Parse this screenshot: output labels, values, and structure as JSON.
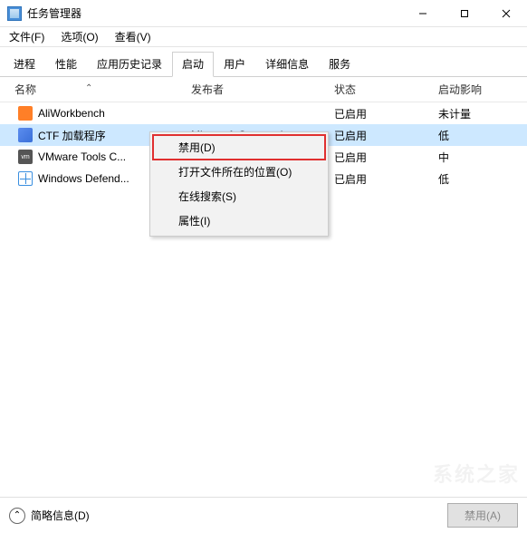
{
  "titlebar": {
    "title": "任务管理器"
  },
  "menubar": {
    "file": "文件(F)",
    "options": "选项(O)",
    "view": "查看(V)"
  },
  "tabs": {
    "items": [
      {
        "label": "进程"
      },
      {
        "label": "性能"
      },
      {
        "label": "应用历史记录"
      },
      {
        "label": "启动"
      },
      {
        "label": "用户"
      },
      {
        "label": "详细信息"
      },
      {
        "label": "服务"
      }
    ],
    "active_index": 3
  },
  "columns": {
    "name": "名称",
    "publisher": "发布者",
    "status": "状态",
    "impact": "启动影响"
  },
  "rows": [
    {
      "name": "AliWorkbench",
      "publisher": "",
      "status": "已启用",
      "impact": "未计量",
      "icon": "ali"
    },
    {
      "name": "CTF 加载程序",
      "publisher": "Microsoft Corporation",
      "status": "已启用",
      "impact": "低",
      "icon": "ctf",
      "selected": true
    },
    {
      "name": "VMware Tools C...",
      "publisher": "",
      "status": "已启用",
      "impact": "中",
      "icon": "vm"
    },
    {
      "name": "Windows Defend...",
      "publisher": "",
      "status": "已启用",
      "impact": "低",
      "icon": "def"
    }
  ],
  "context_menu": {
    "items": [
      {
        "label": "禁用(D)",
        "highlight": true
      },
      {
        "label": "打开文件所在的位置(O)"
      },
      {
        "label": "在线搜索(S)"
      },
      {
        "label": "属性(I)"
      }
    ]
  },
  "statusbar": {
    "detail_toggle": "简略信息(D)",
    "disable_button": "禁用(A)"
  }
}
